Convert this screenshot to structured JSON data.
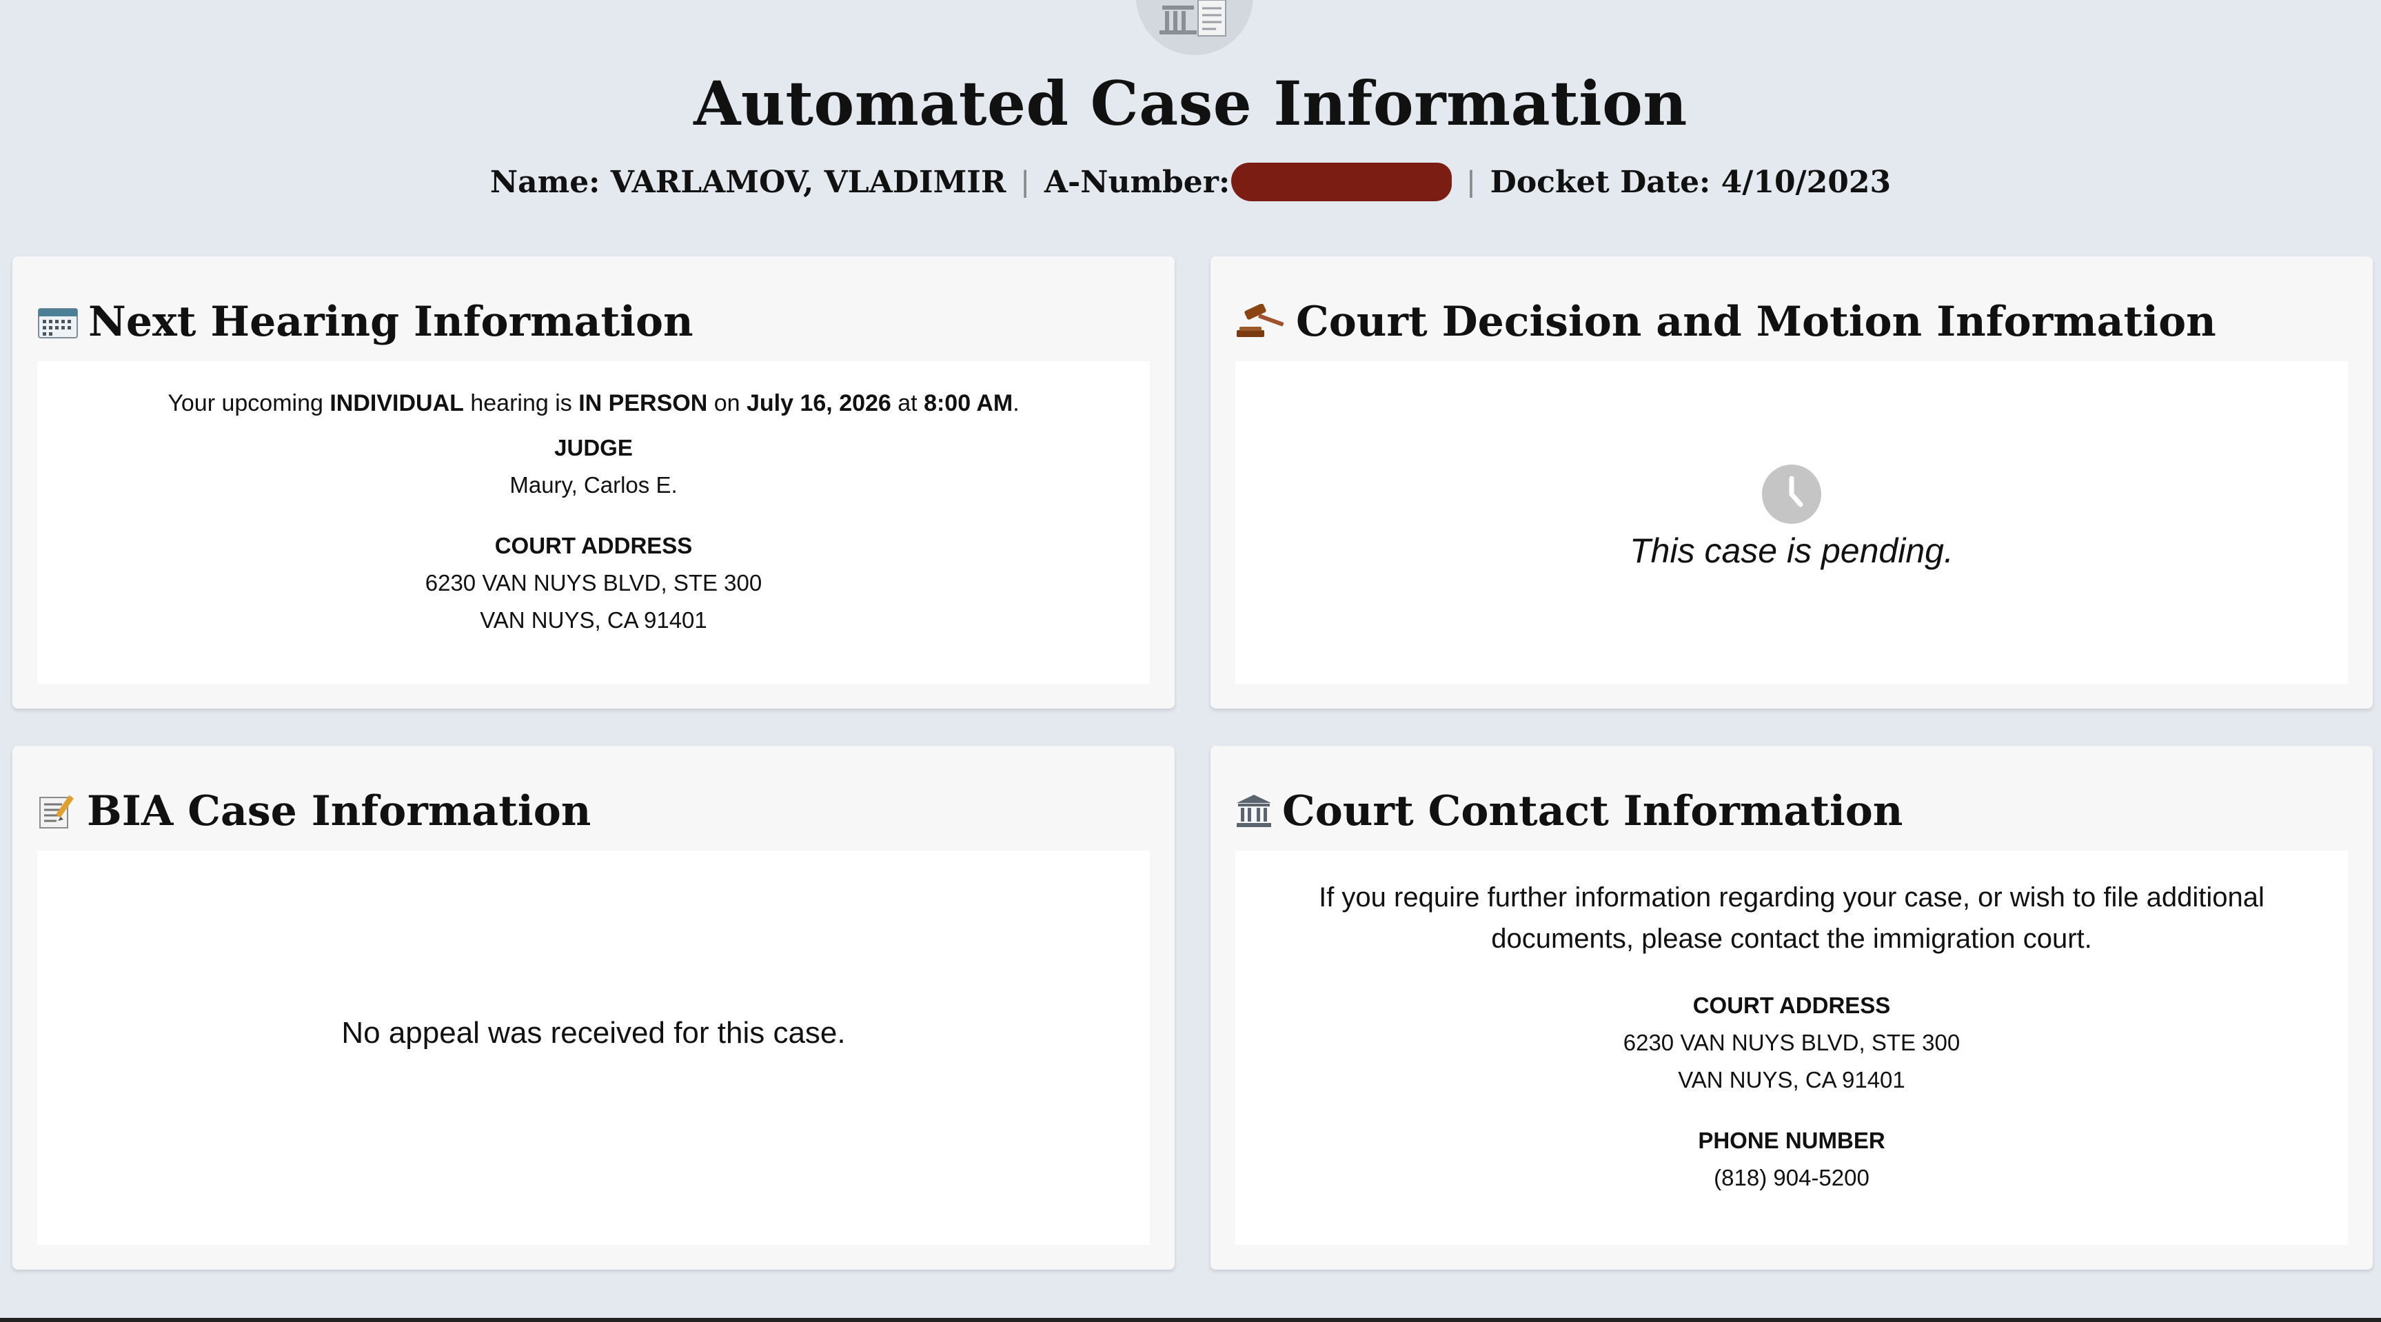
{
  "header": {
    "title": "Automated Case Information",
    "name_label": "Name:",
    "name_value": "VARLAMOV, VLADIMIR",
    "anumber_label": "A-Number:",
    "docket_label": "Docket Date:",
    "docket_value": "4/10/2023"
  },
  "next_hearing": {
    "title": "Next Hearing Information",
    "icon": "calendar-icon",
    "sentence": {
      "p1": "Your upcoming ",
      "hearing_type": "INDIVIDUAL",
      "p2": " hearing is ",
      "mode": "IN PERSON",
      "p3": " on ",
      "date": "July 16, 2026",
      "p4": " at ",
      "time": "8:00 AM",
      "p5": "."
    },
    "judge_label": "JUDGE",
    "judge_name": "Maury, Carlos E.",
    "address_label": "COURT ADDRESS",
    "address_line1": "6230 VAN NUYS BLVD, STE 300",
    "address_line2": "VAN NUYS, CA 91401"
  },
  "court_decision": {
    "title": "Court Decision and Motion Information",
    "icon": "gavel-icon",
    "status_icon": "clock-icon",
    "status_text": "This case is pending."
  },
  "bia": {
    "title": "BIA Case Information",
    "icon": "memo-icon",
    "message": "No appeal was received for this case."
  },
  "court_contact": {
    "title": "Court Contact Information",
    "icon": "courthouse-icon",
    "message": "If you require further information regarding your case, or wish to file additional documents, please contact the immigration court.",
    "address_label": "COURT ADDRESS",
    "address_line1": "6230 VAN NUYS BLVD, STE 300",
    "address_line2": "VAN NUYS, CA 91401",
    "phone_label": "PHONE NUMBER",
    "phone_value": "(818) 904-5200"
  },
  "colors": {
    "page_bg": "#e4e9ef",
    "card_bg": "#f7f7f7",
    "redaction": "#7b1d12"
  }
}
